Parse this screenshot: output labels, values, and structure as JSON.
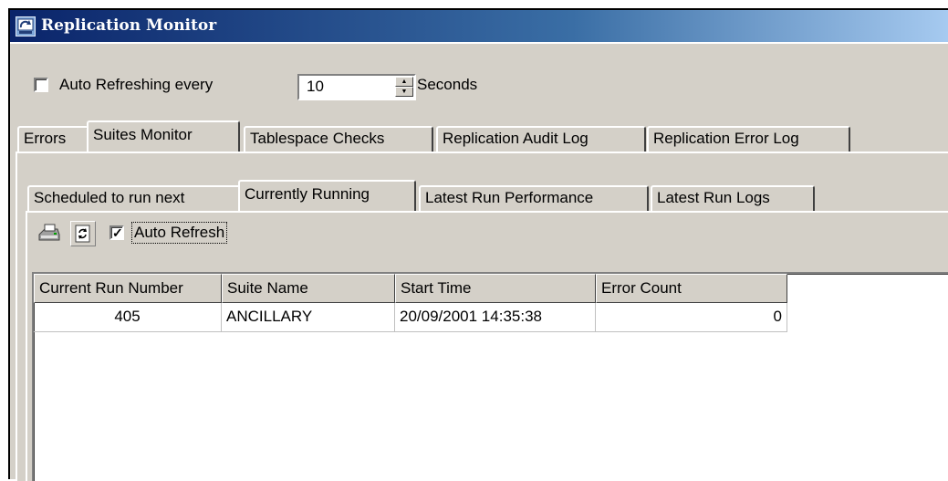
{
  "window": {
    "title": "Replication Monitor"
  },
  "auto_refresh": {
    "checked": false,
    "label": "Auto Refreshing every",
    "interval_value": "10",
    "unit_label": "Seconds"
  },
  "main_tabs": [
    {
      "label": "Errors",
      "active": false
    },
    {
      "label": "Suites Monitor",
      "active": true
    },
    {
      "label": "Tablespace Checks",
      "active": false
    },
    {
      "label": "Replication Audit Log",
      "active": false
    },
    {
      "label": "Replication Error Log",
      "active": false
    }
  ],
  "sub_tabs": [
    {
      "label": "Scheduled to run next",
      "active": false
    },
    {
      "label": "Currently Running",
      "active": true
    },
    {
      "label": "Latest Run Performance",
      "active": false
    },
    {
      "label": "Latest Run Logs",
      "active": false
    }
  ],
  "toolbar": {
    "print_icon": "printer-icon",
    "refresh_icon": "refresh-icon",
    "auto_refresh_checked": true,
    "auto_refresh_label": "Auto Refresh"
  },
  "table": {
    "columns": [
      "Current Run Number",
      "Suite Name",
      "Start Time",
      "Error Count"
    ],
    "rows": [
      [
        "405",
        "ANCILLARY",
        "20/09/2001 14:35:38",
        "0"
      ]
    ]
  },
  "colors": {
    "face": "#d4d0c8",
    "titlebar_start": "#0a246a",
    "titlebar_end": "#a6caf0"
  }
}
